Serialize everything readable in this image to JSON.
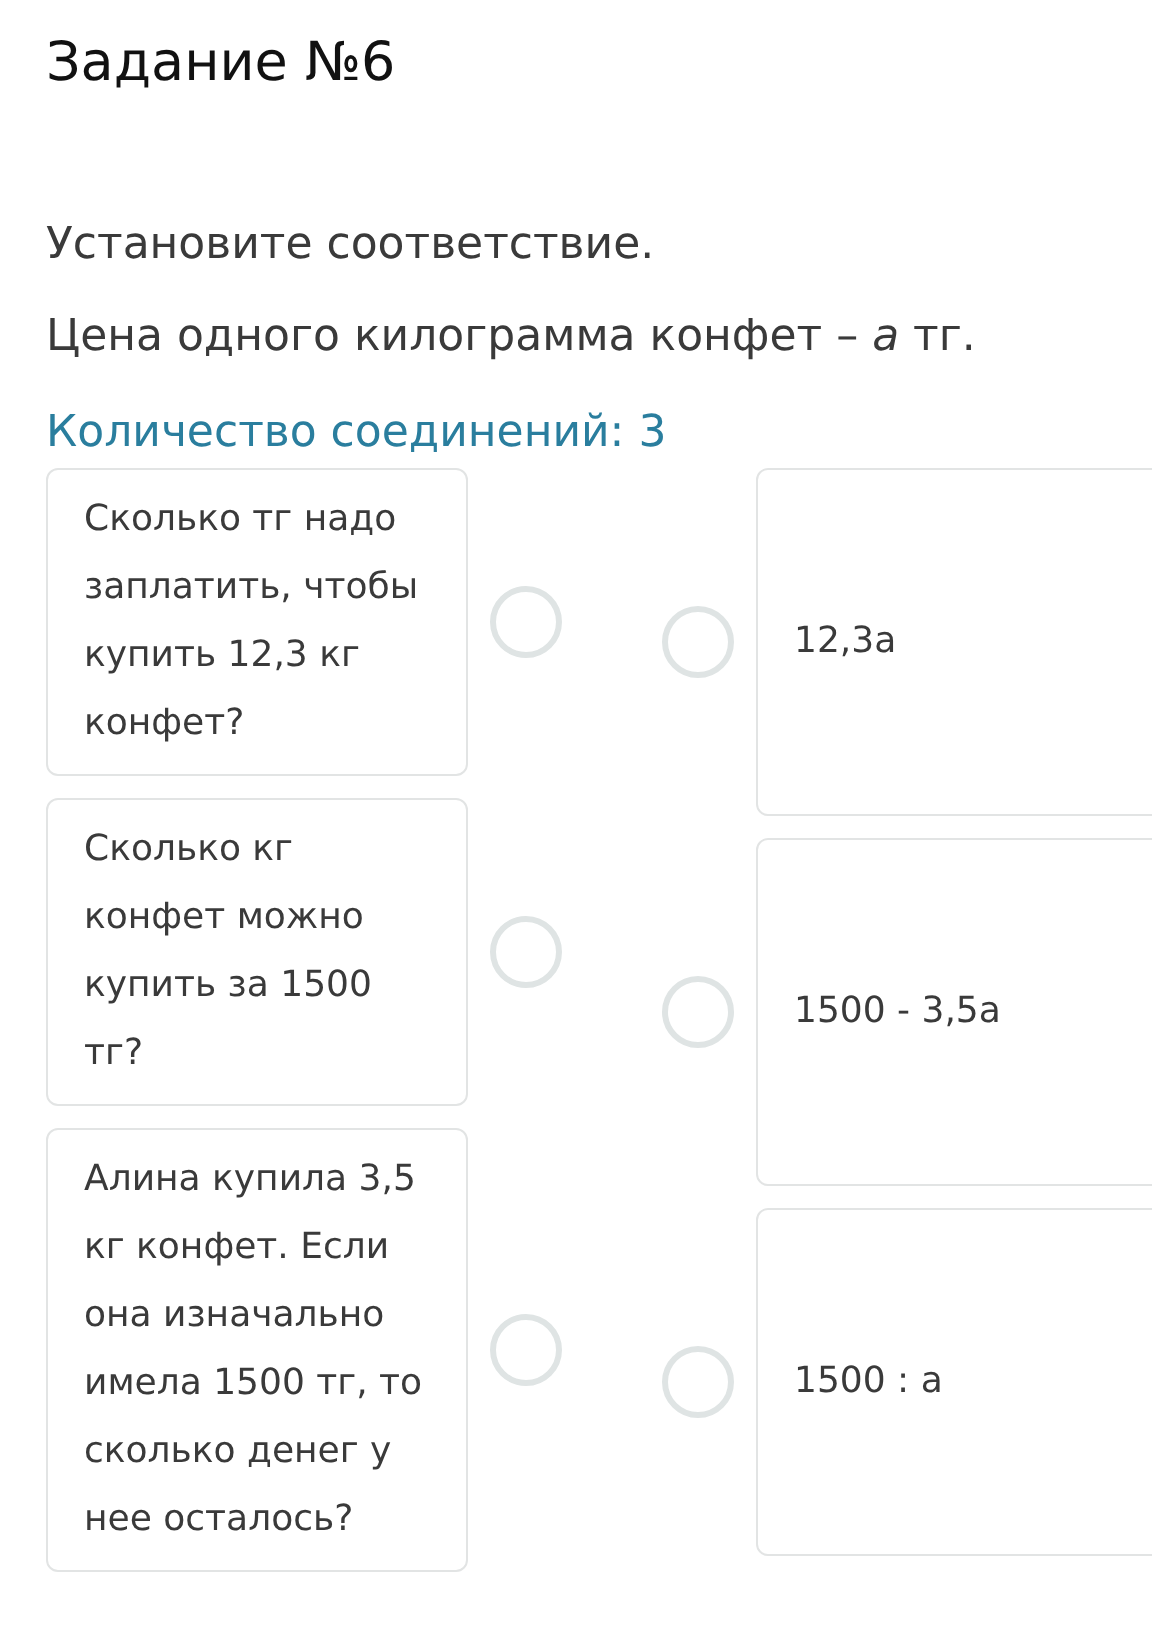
{
  "title": "Задание №6",
  "instructions": [
    "Установите соответствие.",
    "Цена одного килограмма конфет – *a* тг."
  ],
  "connections_label": "Количество соединений: 3",
  "left_items": [
    {
      "text": "Сколько тг надо заплатить, чтобы купить 12,3 кг конфет?"
    },
    {
      "text": "Сколько кг конфет можно купить за 1500 тг?"
    },
    {
      "text": "Алина купила 3,5 кг конфет. Если она изначально имела 1500 тг, то сколько денег у нее осталось?"
    }
  ],
  "right_items": [
    {
      "text": "12,3a"
    },
    {
      "text": "1500 - 3,5a"
    },
    {
      "text": "1500 : a"
    }
  ]
}
